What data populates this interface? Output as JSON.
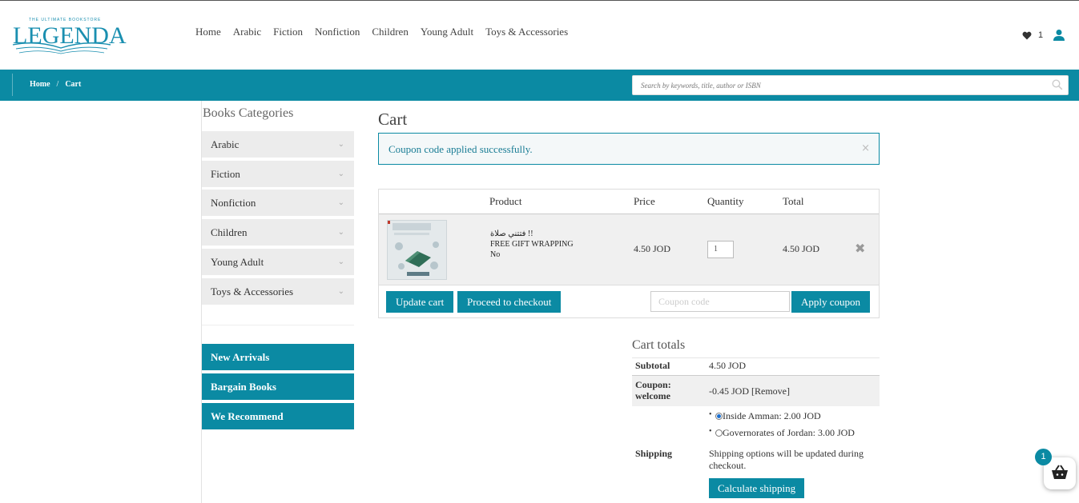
{
  "brand": {
    "name": "LEGENDA",
    "tagline": "THE ULTIMATE BOOKSTORE"
  },
  "nav": {
    "items": [
      "Home",
      "Arabic",
      "Fiction",
      "Nonfiction",
      "Children",
      "Young Adult",
      "Toys & Accessories"
    ]
  },
  "header": {
    "wishlist_count": "1",
    "icons": [
      "heart-icon",
      "user-icon"
    ]
  },
  "breadcrumb": {
    "home": "Home",
    "separator": "/",
    "current": "Cart"
  },
  "search": {
    "placeholder": "Search by keywords, title, author or ISBN",
    "value": ""
  },
  "sidebar": {
    "title": "Books Categories",
    "categories": [
      "Arabic",
      "Fiction",
      "Nonfiction",
      "Children",
      "Young Adult",
      "Toys & Accessories"
    ],
    "blocks": [
      "New Arrivals",
      "Bargain Books",
      "We Recommend"
    ]
  },
  "cart": {
    "title": "Cart",
    "notice": "Coupon code applied successfully.",
    "columns": {
      "product": "Product",
      "price": "Price",
      "quantity": "Quantity",
      "total": "Total"
    },
    "items": [
      {
        "name": "فتتني صلاة !!",
        "meta_label": "FREE GIFT WRAPPING",
        "meta_value": "No",
        "price": "4.50 JOD",
        "quantity": "1",
        "total": "4.50 JOD"
      }
    ],
    "update_label": "Update cart",
    "checkout_label": "Proceed to checkout",
    "coupon_placeholder": "Coupon code",
    "apply_label": "Apply coupon"
  },
  "totals": {
    "title": "Cart totals",
    "subtotal_label": "Subtotal",
    "subtotal_value": "4.50 JOD",
    "coupon_label": "Coupon: welcome",
    "coupon_value": "-0.45 JOD",
    "coupon_remove": "[Remove]",
    "shipping_options": [
      {
        "label": "Inside Amman: 2.00 JOD",
        "selected": true
      },
      {
        "label": "Governorates of Jordan: 3.00 JOD",
        "selected": false
      }
    ],
    "shipping_label": "Shipping",
    "shipping_note": "Shipping options will be updated during checkout.",
    "calc_label": "Calculate shipping"
  },
  "mini_cart": {
    "count": "1"
  },
  "colors": {
    "accent": "#0b8aa3",
    "sidebar_bg": "#ececec",
    "notice_text": "#1a7d95"
  }
}
